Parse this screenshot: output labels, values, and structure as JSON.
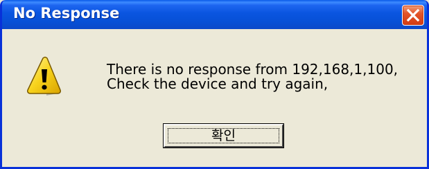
{
  "window": {
    "title": "No Response"
  },
  "dialog": {
    "icon": "warning-icon",
    "message_lines": [
      "There is no response from 192,168,1,100,",
      "Check the device and try again,"
    ],
    "ok_label": "확인"
  },
  "colors": {
    "titlebar": "#0a55e0",
    "close_button": "#e3552a",
    "background": "#ece9d8",
    "warning_yellow": "#f7d21b"
  }
}
